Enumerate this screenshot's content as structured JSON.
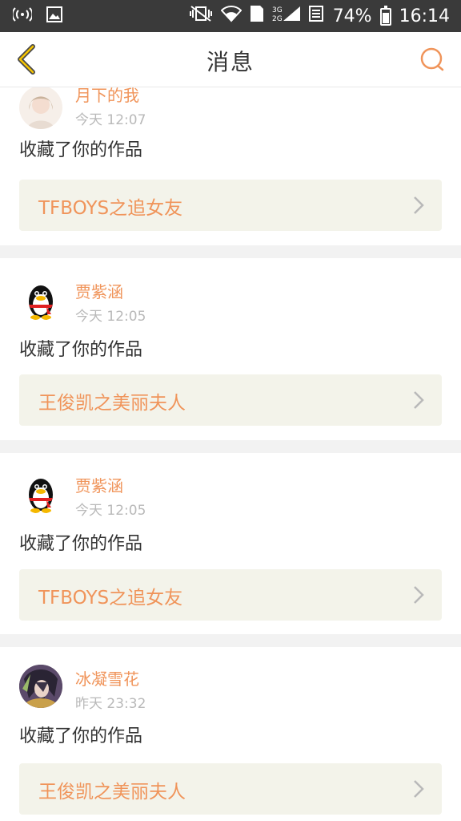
{
  "status_bar": {
    "battery_percent": "74%",
    "time": "16:14",
    "sim_label": "1",
    "network_label": "3G 2G"
  },
  "header": {
    "title": "消息"
  },
  "colors": {
    "accent": "#f0945a",
    "card_bg": "#f3f3ea",
    "text": "#333333",
    "muted": "#b9b9b9"
  },
  "messages": [
    {
      "user": "月下的我",
      "time": "今天 12:07",
      "action": "收藏了你的作品",
      "work": "TFBOYS之追女友",
      "avatar": "girl-photo-avatar"
    },
    {
      "user": "贾紫涵",
      "time": "今天 12:05",
      "action": "收藏了你的作品",
      "work": "王俊凯之美丽夫人",
      "avatar": "qq-penguin-avatar"
    },
    {
      "user": "贾紫涵",
      "time": "今天 12:05",
      "action": "收藏了你的作品",
      "work": "TFBOYS之追女友",
      "avatar": "qq-penguin-avatar"
    },
    {
      "user": "冰凝雪花",
      "time": "昨天 23:32",
      "action": "收藏了你的作品",
      "work": "王俊凯之美丽夫人",
      "avatar": "anime-character-avatar"
    }
  ]
}
